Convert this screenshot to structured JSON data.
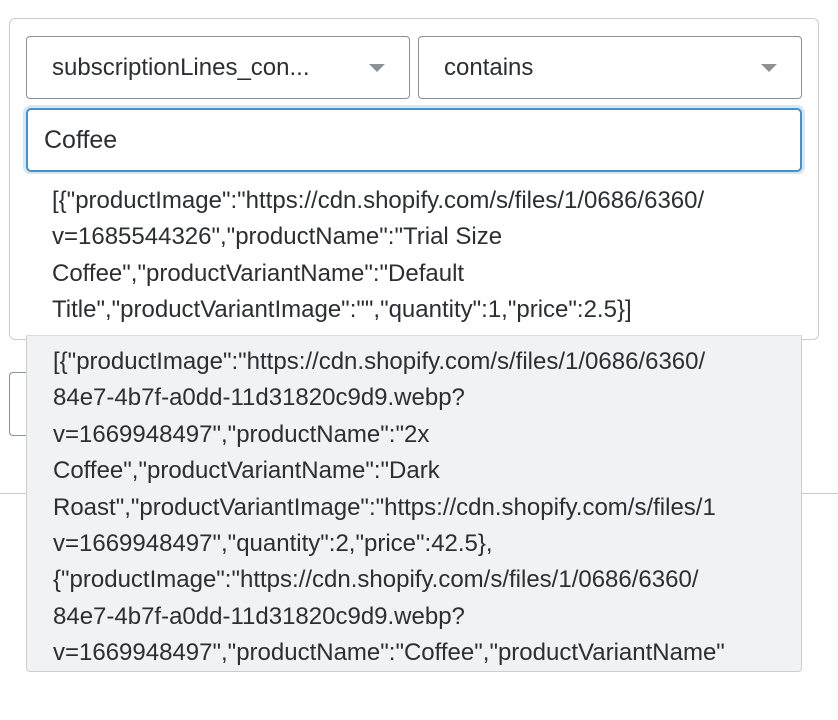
{
  "filter": {
    "field_select": {
      "value": "subscriptionLines_con..."
    },
    "operator_select": {
      "value": "contains"
    },
    "search": {
      "value": "Coffee"
    }
  },
  "results": [
    {
      "lines": [
        "[{\"productImage\":\"https://cdn.shopify.com/s/files/1/0686/6360/",
        "v=1685544326\",\"productName\":\"Trial Size",
        "Coffee\",\"productVariantName\":\"Default",
        "Title\",\"productVariantImage\":\"\",\"quantity\":1,\"price\":2.5}]"
      ]
    },
    {
      "lines": [
        "[{\"productImage\":\"https://cdn.shopify.com/s/files/1/0686/6360/",
        "84e7-4b7f-a0dd-11d31820c9d9.webp?",
        "v=1669948497\",\"productName\":\"2x",
        "Coffee\",\"productVariantName\":\"Dark",
        "Roast\",\"productVariantImage\":\"https://cdn.shopify.com/s/files/1",
        "v=1669948497\",\"quantity\":2,\"price\":42.5},",
        "{\"productImage\":\"https://cdn.shopify.com/s/files/1/0686/6360/",
        "84e7-4b7f-a0dd-11d31820c9d9.webp?",
        "v=1669948497\",\"productName\":\"Coffee\",\"productVariantName\""
      ]
    }
  ]
}
